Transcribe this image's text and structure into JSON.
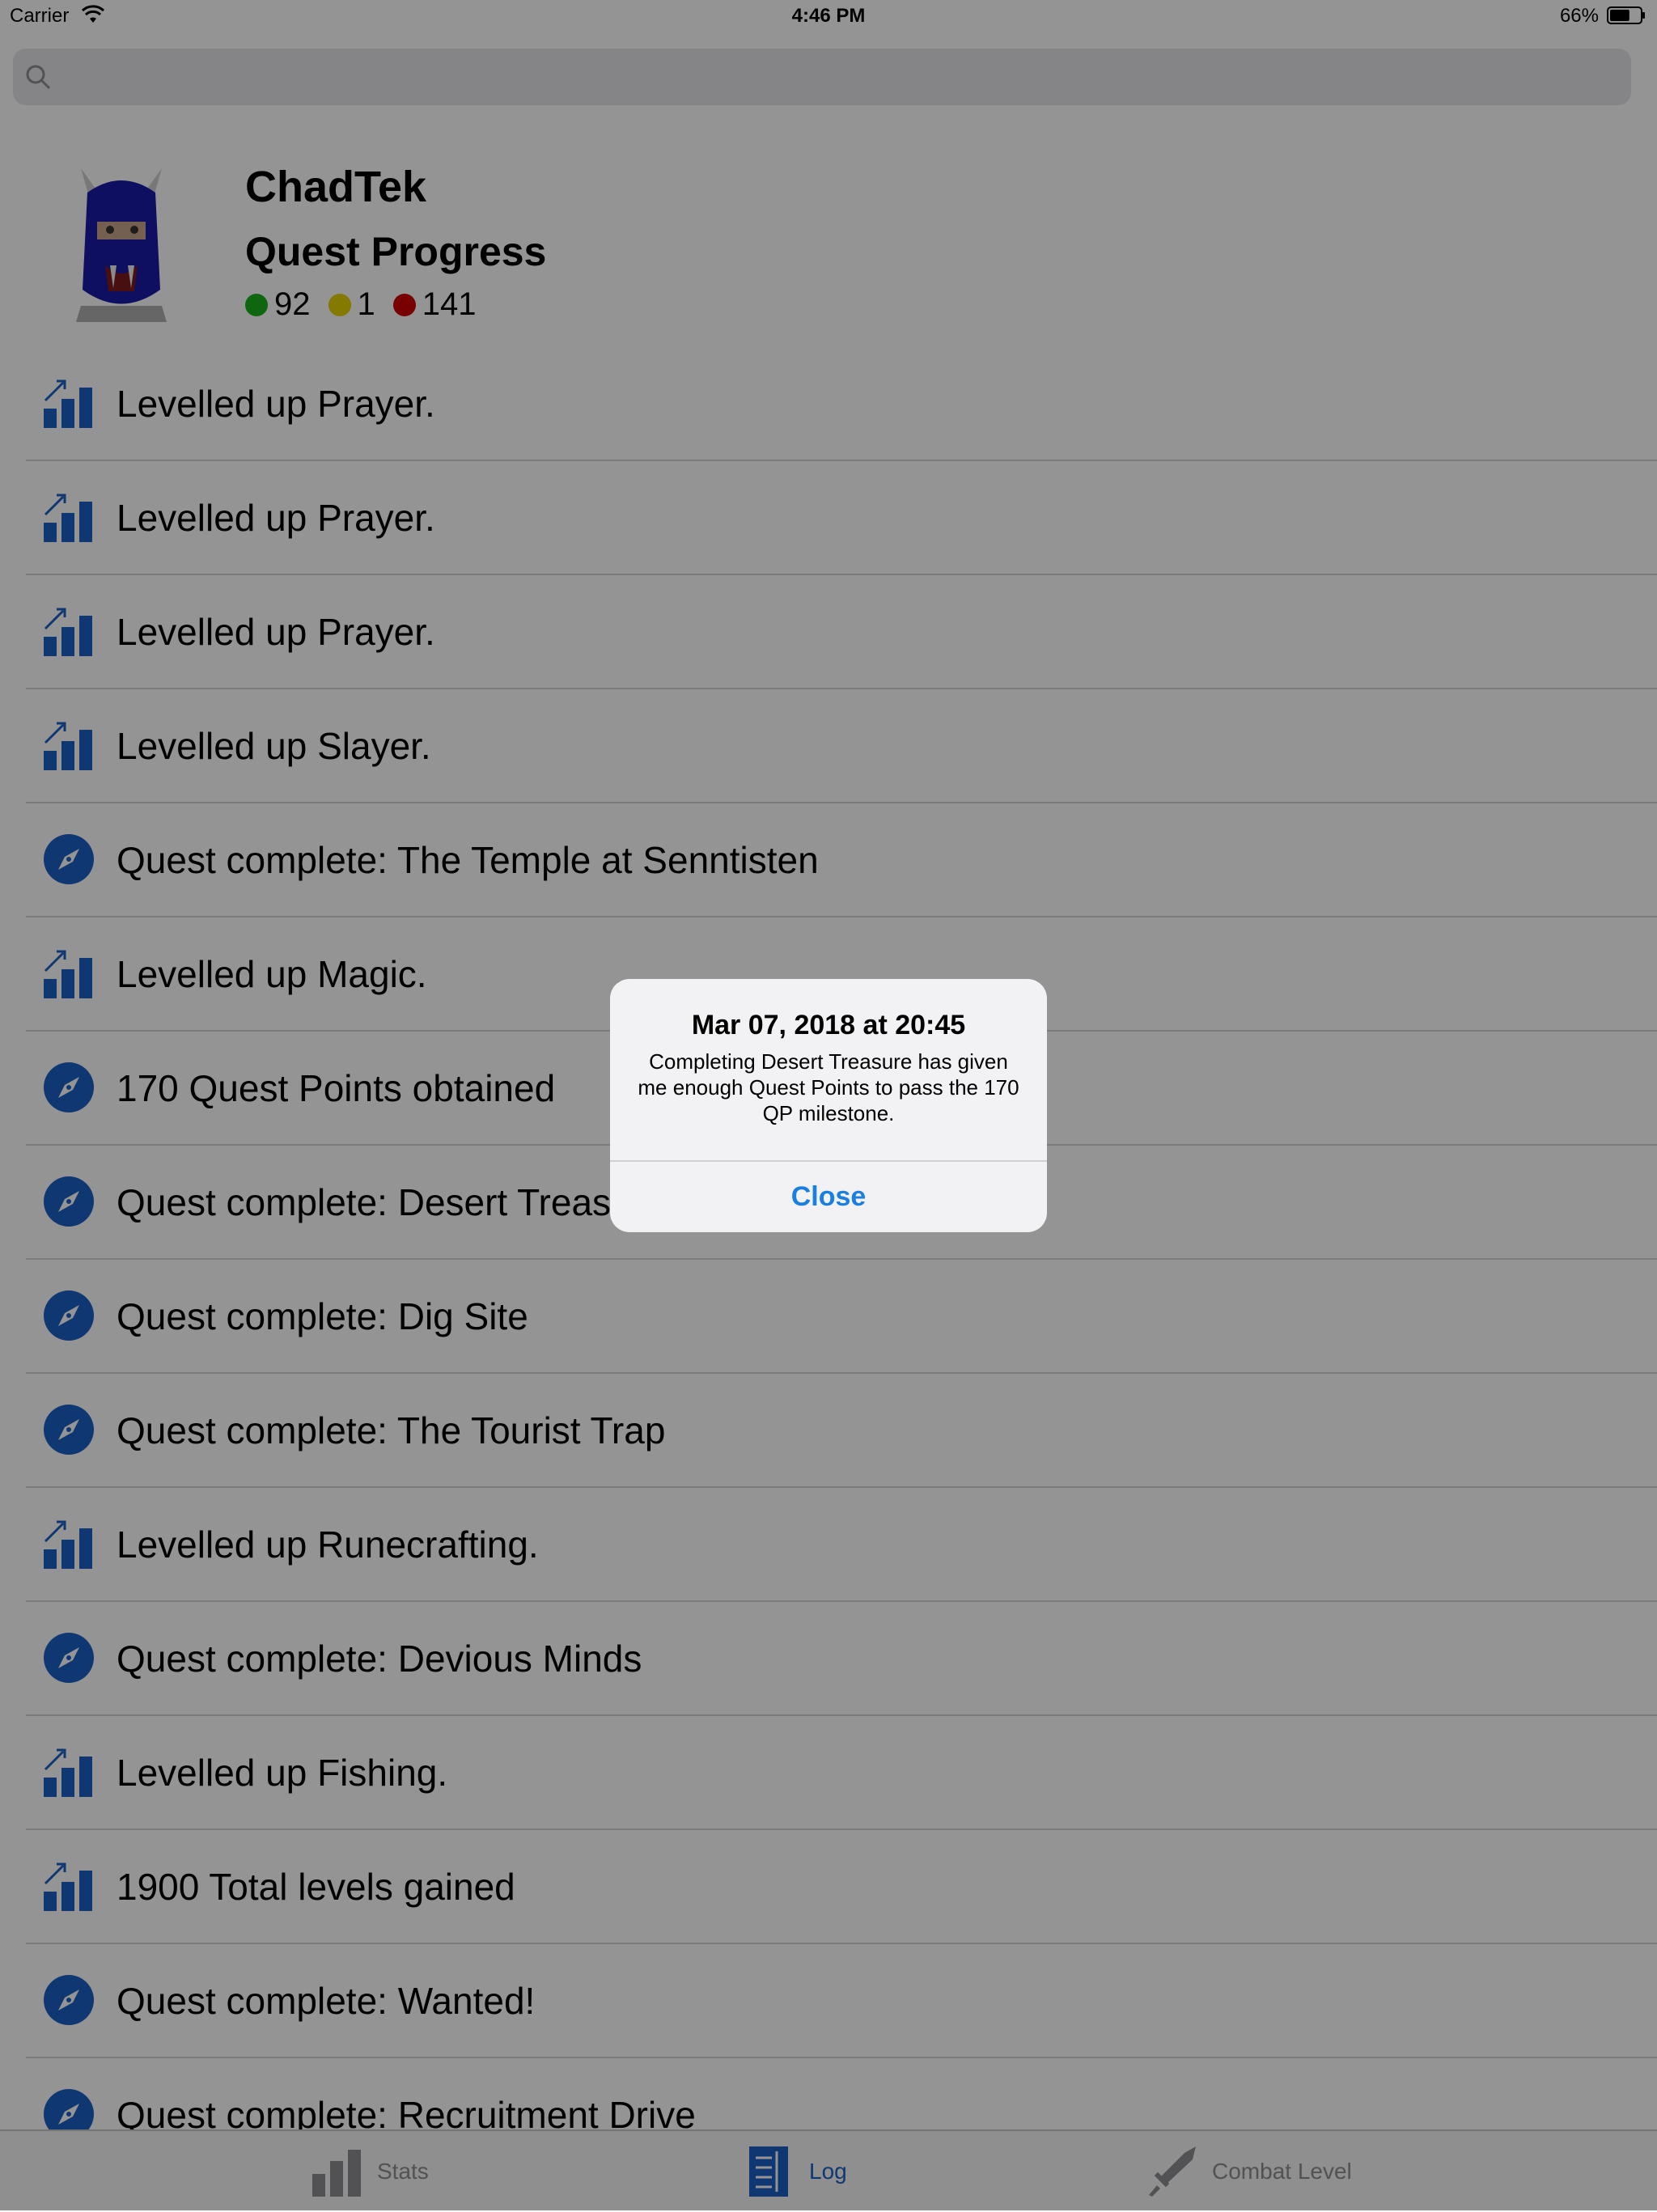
{
  "status_bar": {
    "carrier": "Carrier",
    "time": "4:46 PM",
    "battery": "66%",
    "battery_level": 0.66
  },
  "search": {
    "placeholder": "",
    "value": ""
  },
  "profile": {
    "name": "ChadTek",
    "section_title": "Quest Progress",
    "counts": [
      {
        "value": "92",
        "color": "#19b219"
      },
      {
        "value": "1",
        "color": "#e3d200"
      },
      {
        "value": "141",
        "color": "#d10000"
      }
    ]
  },
  "log": {
    "items": [
      {
        "icon": "levelup-icon",
        "text": "Levelled up Prayer."
      },
      {
        "icon": "levelup-icon",
        "text": "Levelled up Prayer."
      },
      {
        "icon": "levelup-icon",
        "text": "Levelled up Prayer."
      },
      {
        "icon": "levelup-icon",
        "text": "Levelled up Slayer."
      },
      {
        "icon": "compass-icon",
        "text": "Quest complete: The Temple at Senntisten"
      },
      {
        "icon": "levelup-icon",
        "text": "Levelled up Magic."
      },
      {
        "icon": "compass-icon",
        "text": "170 Quest Points obtained"
      },
      {
        "icon": "compass-icon",
        "text": "Quest complete: Desert Treasure"
      },
      {
        "icon": "compass-icon",
        "text": "Quest complete: Dig Site"
      },
      {
        "icon": "compass-icon",
        "text": "Quest complete: The Tourist Trap"
      },
      {
        "icon": "levelup-icon",
        "text": "Levelled up Runecrafting."
      },
      {
        "icon": "compass-icon",
        "text": "Quest complete: Devious Minds"
      },
      {
        "icon": "levelup-icon",
        "text": "Levelled up Fishing."
      },
      {
        "icon": "levelup-icon",
        "text": "1900 Total levels gained"
      },
      {
        "icon": "compass-icon",
        "text": "Quest complete: Wanted!"
      },
      {
        "icon": "compass-icon",
        "text": "Quest complete: Recruitment Drive"
      }
    ]
  },
  "tabs": [
    {
      "label": "Stats",
      "icon": "stats-icon",
      "active": false
    },
    {
      "label": "Log",
      "icon": "log-icon",
      "active": true
    },
    {
      "label": "Combat Level",
      "icon": "sword-icon",
      "active": false
    }
  ],
  "alert": {
    "title": "Mar 07, 2018 at 20:45",
    "message": "Completing Desert Treasure has given me enough Quest Points to pass the 170 QP milestone.",
    "close_label": "Close"
  },
  "colors": {
    "accent_blue": "#1a5fc4",
    "alert_button": "#1a7fe0"
  }
}
